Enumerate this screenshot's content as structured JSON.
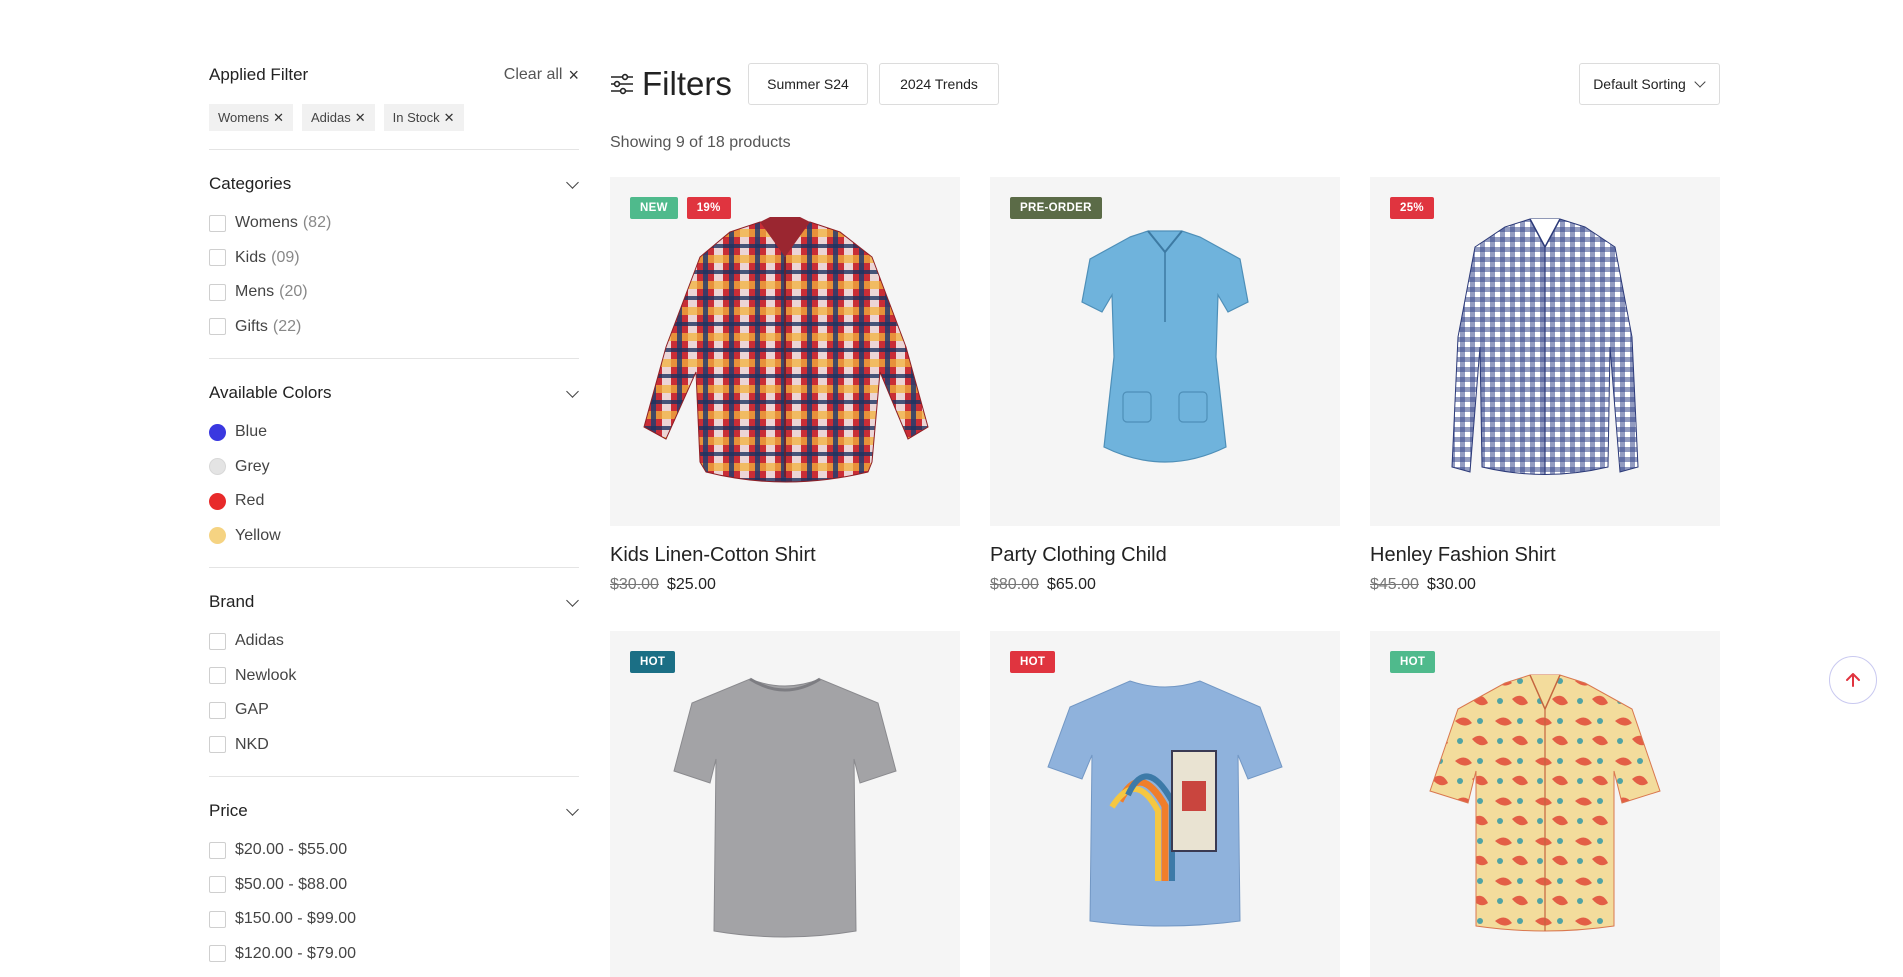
{
  "applied_filter": {
    "title": "Applied Filter",
    "clear_all": "Clear all",
    "chips": [
      "Womens",
      "Adidas",
      "In Stock"
    ]
  },
  "categories": {
    "title": "Categories",
    "items": [
      {
        "label": "Womens",
        "count": "(82)"
      },
      {
        "label": "Kids",
        "count": "(09)"
      },
      {
        "label": "Mens",
        "count": "(20)"
      },
      {
        "label": "Gifts",
        "count": "(22)"
      }
    ]
  },
  "colors": {
    "title": "Available Colors",
    "items": [
      {
        "label": "Blue",
        "color": "#3a38e0"
      },
      {
        "label": "Grey",
        "color": "#e4e4e4"
      },
      {
        "label": "Red",
        "color": "#e82a2a"
      },
      {
        "label": "Yellow",
        "color": "#f5d382"
      }
    ]
  },
  "brand": {
    "title": "Brand",
    "items": [
      "Adidas",
      "Newlook",
      "GAP",
      "NKD"
    ]
  },
  "price": {
    "title": "Price",
    "items": [
      "$20.00 - $55.00",
      "$50.00 - $88.00",
      "$150.00 - $99.00",
      "$120.00 - $79.00"
    ]
  },
  "toolbar": {
    "filters_label": "Filters",
    "tags": [
      "Summer S24",
      "2024 Trends"
    ],
    "sort_label": "Default Sorting"
  },
  "showing_text": "Showing 9 of 18 products",
  "products": [
    {
      "name": "Kids Linen-Cotton Shirt",
      "old_price": "$30.00",
      "price": "$25.00",
      "badges": [
        {
          "text": "NEW",
          "color": "#4fba8c"
        },
        {
          "text": "19%",
          "color": "#e0343f"
        }
      ],
      "image": "plaid-shirt"
    },
    {
      "name": "Party Clothing Child",
      "old_price": "$80.00",
      "price": "$65.00",
      "badges": [
        {
          "text": "PRE-ORDER",
          "color": "#5b6b47"
        }
      ],
      "image": "scrub-top"
    },
    {
      "name": "Henley Fashion Shirt",
      "old_price": "$45.00",
      "price": "$30.00",
      "badges": [
        {
          "text": "25%",
          "color": "#e0343f"
        }
      ],
      "image": "gingham-shirt"
    },
    {
      "name": "",
      "old_price": "",
      "price": "",
      "badges": [
        {
          "text": "HOT",
          "color": "#1b6f85"
        }
      ],
      "image": "grey-tee"
    },
    {
      "name": "",
      "old_price": "",
      "price": "",
      "badges": [
        {
          "text": "HOT",
          "color": "#e0343f"
        }
      ],
      "image": "blue-graphic-tee"
    },
    {
      "name": "",
      "old_price": "",
      "price": "",
      "badges": [
        {
          "text": "HOT",
          "color": "#4fba8c"
        }
      ],
      "image": "floral-shirt"
    }
  ]
}
